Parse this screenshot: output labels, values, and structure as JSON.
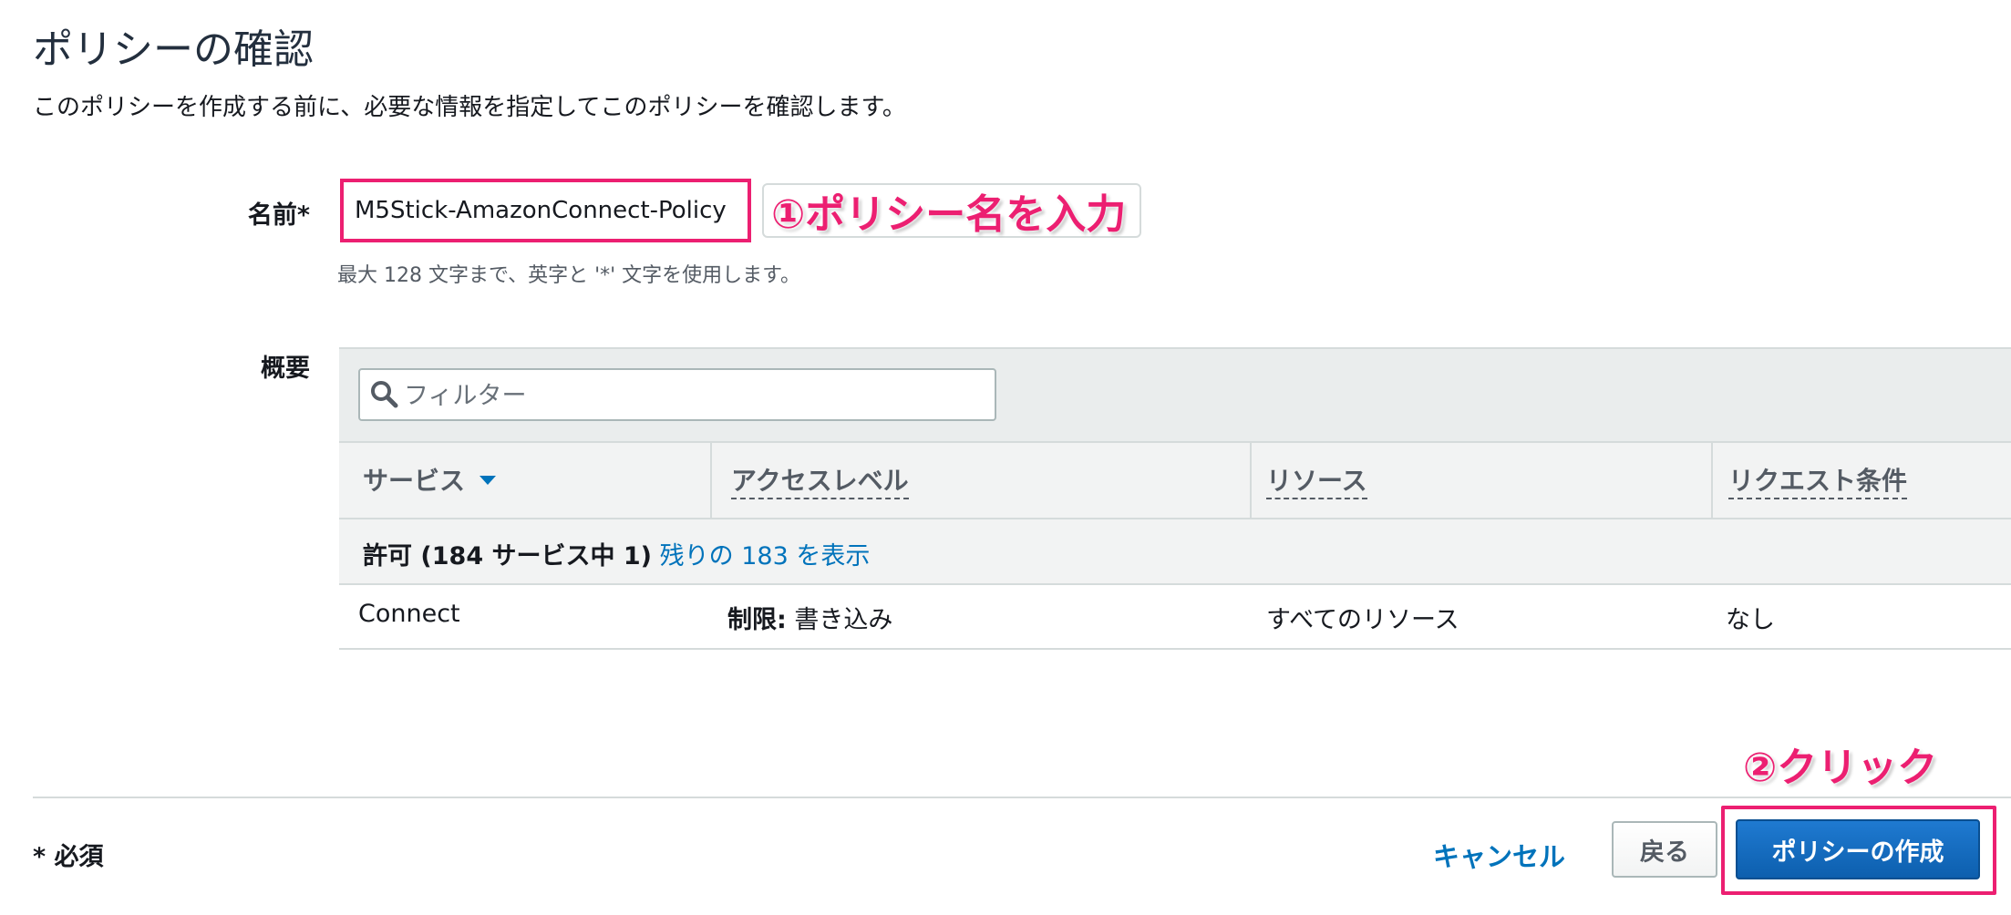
{
  "page": {
    "title": "ポリシーの確認",
    "description": "このポリシーを作成する前に、必要な情報を指定してこのポリシーを確認します。"
  },
  "name_field": {
    "label": "名前*",
    "value": "M5Stick-AmazonConnect-Policy",
    "hint": "最大 128 文字まで、英字と '*' 文字を使用します。",
    "annotation": "①ポリシー名を入力"
  },
  "summary": {
    "label": "概要",
    "filter_placeholder": "フィルター",
    "columns": [
      "サービス",
      "アクセスレベル",
      "リソース",
      "リクエスト条件"
    ],
    "group": {
      "allow_text": "許可 (184 サービス中 1)",
      "show_remaining_link": "残りの 183 を表示"
    },
    "rows": [
      {
        "service": "Connect",
        "access_level_prefix": "制限:",
        "access_level": "書き込み",
        "resource": "すべてのリソース",
        "condition": "なし"
      }
    ]
  },
  "footer": {
    "required_note": "* 必須",
    "cancel_label": "キャンセル",
    "back_label": "戻る",
    "create_label": "ポリシーの作成",
    "annotation": "②クリック"
  },
  "colors": {
    "annotation": "#ec1f71",
    "link": "#0073bb",
    "primary_button": "#1166bb"
  }
}
